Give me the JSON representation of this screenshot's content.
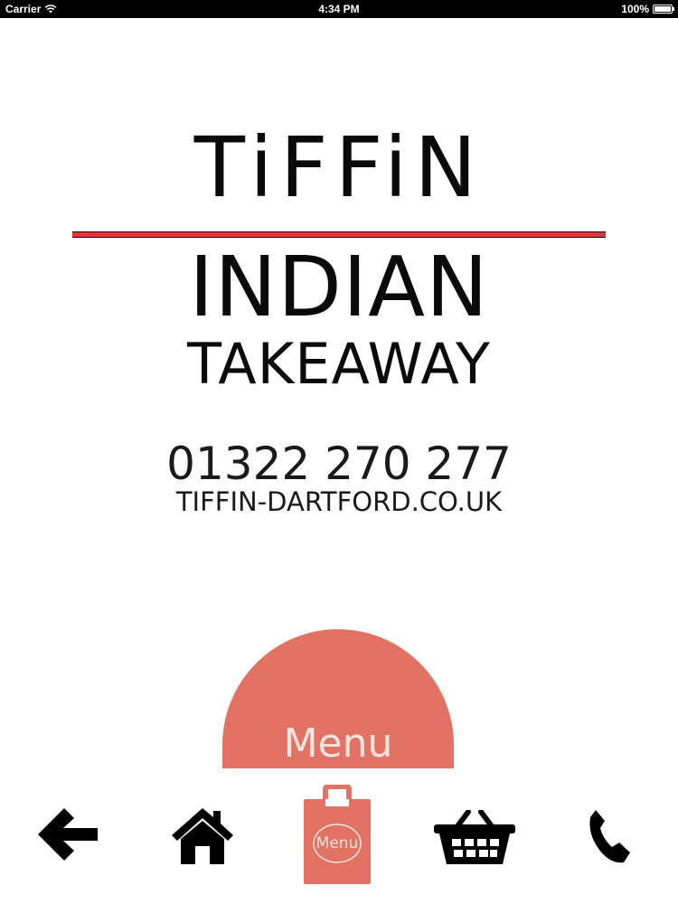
{
  "status_bar": {
    "carrier": "Carrier",
    "time": "4:34 PM",
    "battery": "100%"
  },
  "logo": {
    "title": "TiFFiN",
    "line2": "INDIAN",
    "line3": "TAKEAWAY"
  },
  "contact": {
    "phone": "01322 270 277",
    "website": "TIFFIN-DARTFORD.CO.UK"
  },
  "menu_button": {
    "label": "Menu"
  },
  "tab_bar": {
    "items": [
      {
        "icon": "back-arrow-icon"
      },
      {
        "icon": "home-icon"
      },
      {
        "icon": "menu-bag-icon",
        "label": "Menu"
      },
      {
        "icon": "basket-icon"
      },
      {
        "icon": "phone-icon"
      }
    ]
  },
  "colors": {
    "accent": "#e27364",
    "rule": "#d83a3a",
    "text": "#0a0a0a"
  }
}
